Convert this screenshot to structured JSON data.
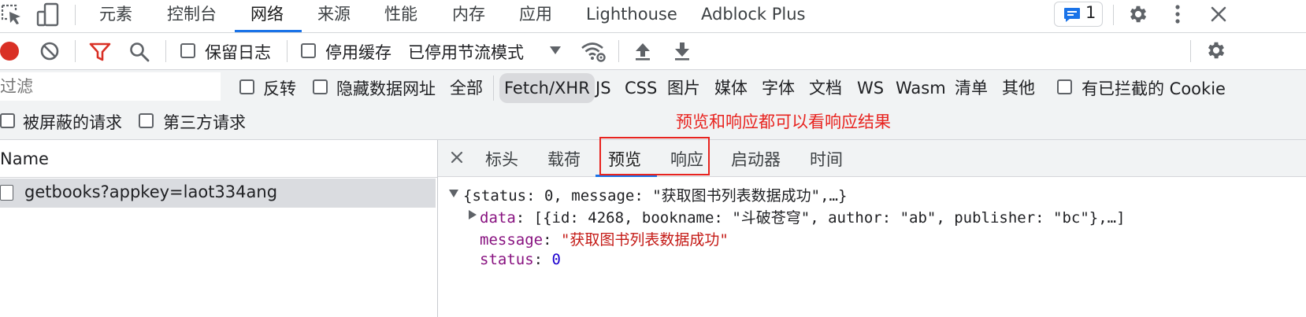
{
  "tabs": {
    "items": [
      "元素",
      "控制台",
      "网络",
      "来源",
      "性能",
      "内存",
      "应用",
      "Lighthouse",
      "Adblock Plus"
    ],
    "active_index": 2,
    "issues_count": "1"
  },
  "toolbar": {
    "preserve_log": "保留日志",
    "disable_cache": "停用缓存",
    "throttling": "已停用节流模式"
  },
  "filter": {
    "placeholder": "过滤",
    "invert": "反转",
    "hide_data_urls": "隐藏数据网址",
    "types": [
      "全部",
      "Fetch/XHR",
      "JS",
      "CSS",
      "图片",
      "媒体",
      "字体",
      "文档",
      "WS",
      "Wasm",
      "清单",
      "其他"
    ],
    "active_type": "Fetch/XHR",
    "blocked_cookies": "有已拦截的 Cookie",
    "blocked_requests": "被屏蔽的请求",
    "third_party": "第三方请求"
  },
  "annotation": "预览和响应都可以看响应结果",
  "requests": {
    "column_name": "Name",
    "rows": [
      "getbooks?appkey=laot334ang"
    ]
  },
  "detail_tabs": {
    "items": [
      "标头",
      "载荷",
      "预览",
      "响应",
      "启动器",
      "时间"
    ],
    "active_index": 2
  },
  "preview": {
    "summary": "{status: 0, message: \"获取图书列表数据成功\",…}",
    "data_key": "data",
    "data_value": "[{id: 4268, bookname: \"斗破苍穹\", author: \"ab\", publisher: \"bc\"},…]",
    "message_key": "message",
    "message_value": "\"获取图书列表数据成功\"",
    "status_key": "status",
    "status_value": "0"
  },
  "colors": {
    "accent": "#1a73e8",
    "record_red": "#d93025",
    "annotation_red": "#e8231f",
    "json_key": "#881280",
    "json_string": "#c41a16",
    "json_number": "#1c00cf"
  }
}
